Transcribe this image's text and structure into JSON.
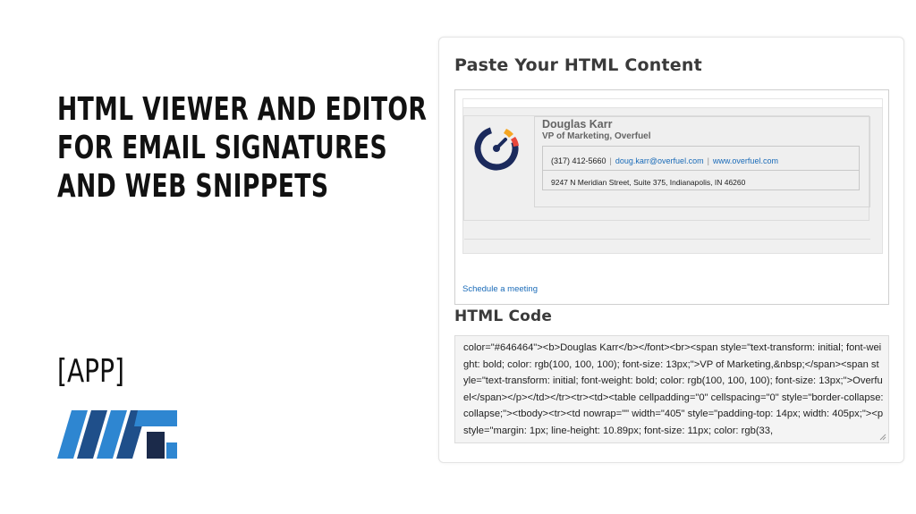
{
  "headline": {
    "line1": "HTML VIEWER AND EDITOR",
    "line2": "FOR EMAIL SIGNATURES",
    "line3": "AND WEB SNIPPETS"
  },
  "app_tag": "[APP]",
  "brand": {
    "logo_icon": "mtk-logo-icon",
    "colors": {
      "dark_blue": "#1f4f8a",
      "light_blue": "#2e86d1",
      "navy": "#1b2a4a"
    }
  },
  "card": {
    "paste_title": "Paste Your HTML Content",
    "preview": {
      "sig_name": "Douglas Karr",
      "sig_role": "VP of Marketing, Overfuel",
      "phone": "(317) 412-5660",
      "separator": "|",
      "email": "doug.karr@overfuel.com",
      "website": "www.overfuel.com",
      "address": "9247 N Meridian Street, Suite 375, Indianapolis, IN 46260",
      "schedule_link": "Schedule a meeting",
      "logo_icon": "overfuel-gauge-icon"
    },
    "code_title": "HTML Code",
    "code_text": "color=\"#646464\"><b>Douglas Karr</b></font><br><span style=\"text-transform: initial; font-weight: bold; color: rgb(100, 100, 100); font-size: 13px;\">VP of Marketing,&nbsp;</span><span style=\"text-transform: initial; font-weight: bold; color: rgb(100, 100, 100); font-size: 13px;\">Overfuel</span></p></td></tr><tr><td><table cellpadding=\"0\" cellspacing=\"0\" style=\"border-collapse: collapse;\"><tbody><tr><td nowrap=\"\" width=\"405\" style=\"padding-top: 14px; width: 405px;\"><p style=\"margin: 1px; line-height: 10.89px; font-size: 11px; color: rgb(33,"
  }
}
